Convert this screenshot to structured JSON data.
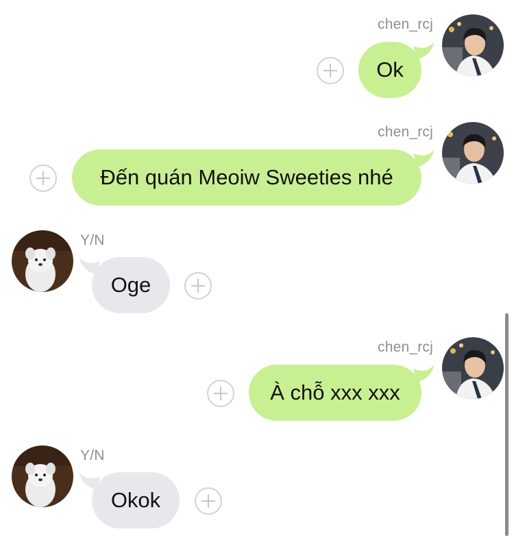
{
  "messages": [
    {
      "sender": "chen_rcj",
      "direction": "outgoing",
      "text": "Ok",
      "avatar": "man-avatar-icon"
    },
    {
      "sender": "chen_rcj",
      "direction": "outgoing",
      "text": "Đến quán Meoiw Sweeties nhé",
      "avatar": "man-avatar-icon"
    },
    {
      "sender": "Y/N",
      "direction": "incoming",
      "text": "Oge",
      "avatar": "dog-avatar-icon"
    },
    {
      "sender": "chen_rcj",
      "direction": "outgoing",
      "text": "À chỗ xxx xxx",
      "avatar": "man-avatar-icon"
    },
    {
      "sender": "Y/N",
      "direction": "incoming",
      "text": "Okok",
      "avatar": "dog-avatar-icon"
    }
  ],
  "colors": {
    "outgoing_bubble": "#c9ef93",
    "incoming_bubble": "#e6e8ec",
    "sender_name": "#8e8e93",
    "add_button": "#d2d2d6"
  },
  "icons": {
    "add_reaction": "plus-circle-icon"
  }
}
